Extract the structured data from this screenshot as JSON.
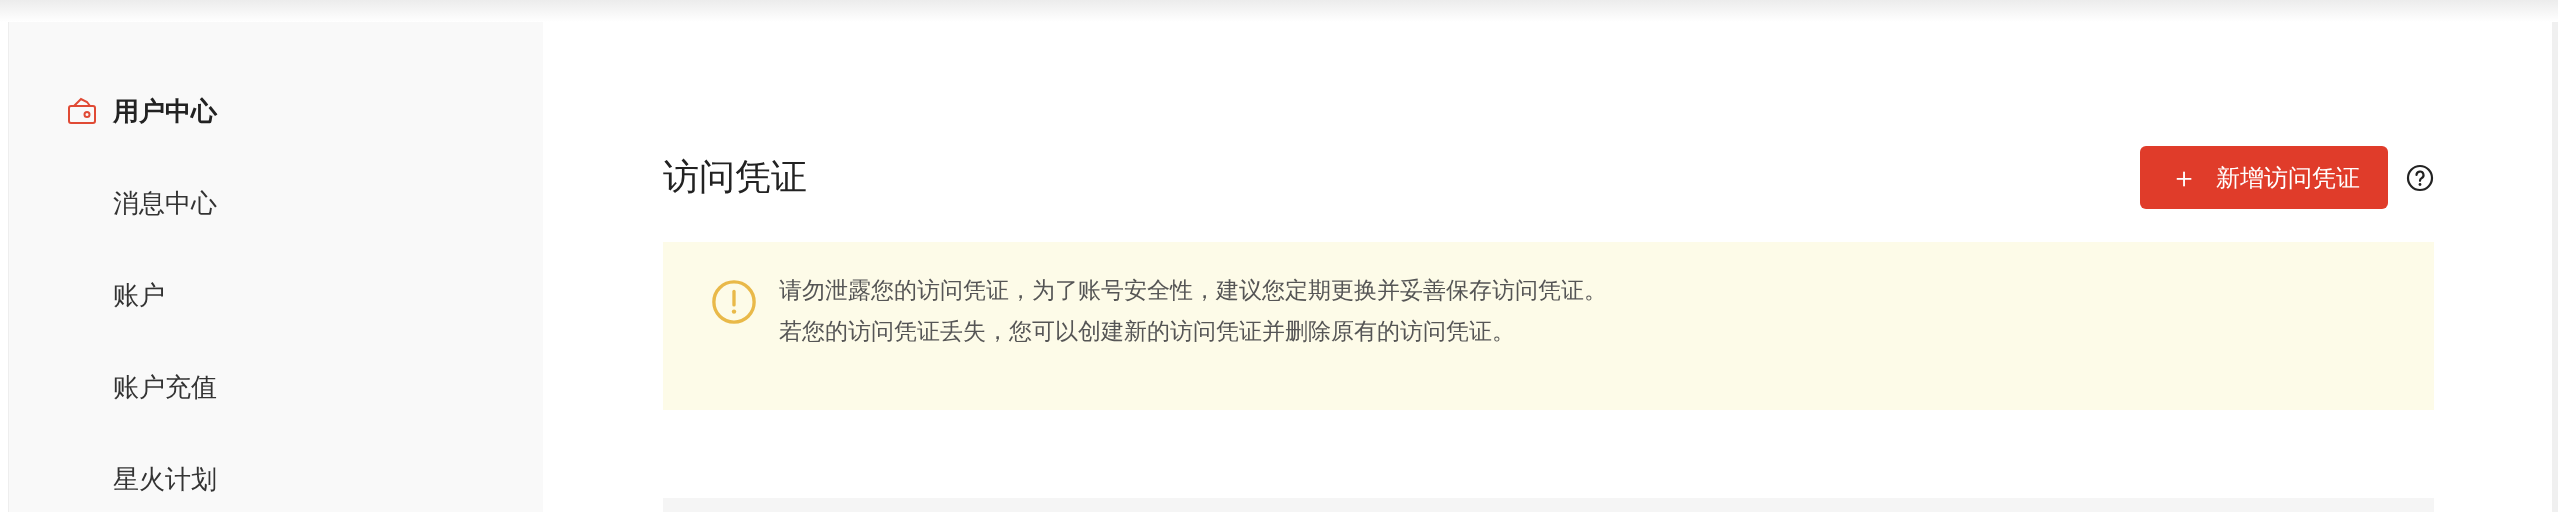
{
  "sidebar": {
    "items": [
      {
        "label": "用户中心",
        "selected": true
      },
      {
        "label": "消息中心",
        "selected": false
      },
      {
        "label": "账户",
        "selected": false
      },
      {
        "label": "账户充值",
        "selected": false
      },
      {
        "label": "星火计划",
        "selected": false
      }
    ]
  },
  "main": {
    "title": "访问凭证",
    "add_button": {
      "icon": "＋",
      "label": "新增访问凭证"
    },
    "notice": {
      "lines": [
        "请勿泄露您的访问凭证，为了账号安全性，建议您定期更换并妥善保存访问凭证。",
        "若您的访问凭证丢失，您可以创建新的访问凭证并删除原有的访问凭证。"
      ]
    }
  }
}
